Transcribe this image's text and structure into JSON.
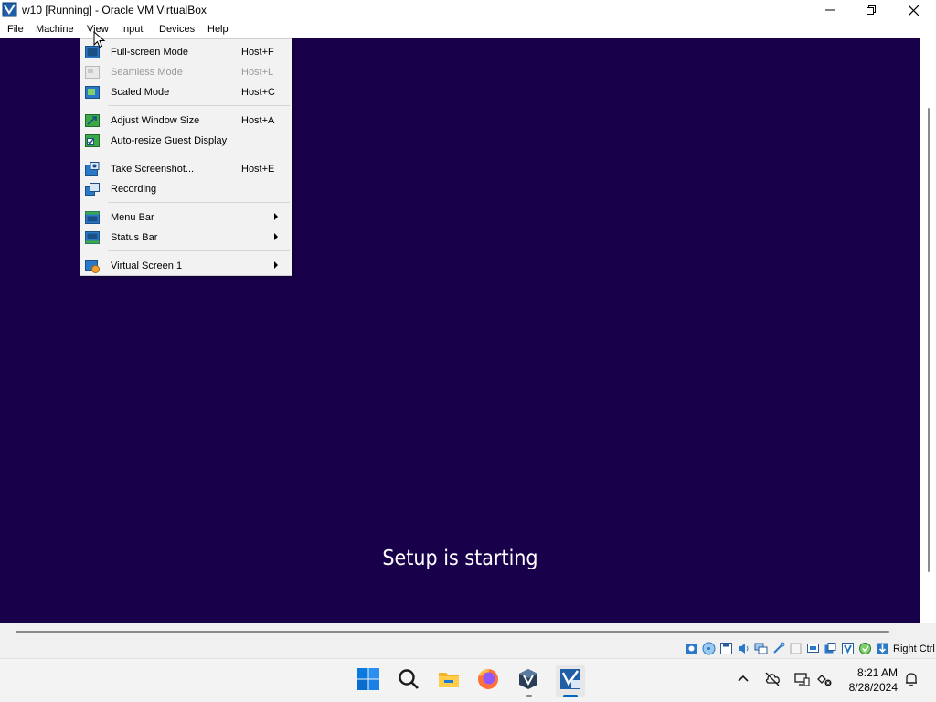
{
  "window": {
    "title": "w10 [Running] - Oracle VM VirtualBox",
    "controls": [
      "minimize-icon",
      "restore-icon",
      "close-icon"
    ]
  },
  "menubar": {
    "items": [
      "File",
      "Machine",
      "View",
      "Input",
      "Devices",
      "Help"
    ],
    "open_menu": "View"
  },
  "view_menu": {
    "items": [
      {
        "label": "Full-screen Mode",
        "shortcut": "Host+F",
        "icon": "fullscreen-icon",
        "enabled": true
      },
      {
        "label": "Seamless Mode",
        "shortcut": "Host+L",
        "icon": "seamless-icon",
        "enabled": false
      },
      {
        "label": "Scaled Mode",
        "shortcut": "Host+C",
        "icon": "scaled-icon",
        "enabled": true
      },
      {
        "label": "Adjust Window Size",
        "shortcut": "Host+A",
        "icon": "adjust-window-icon",
        "enabled": true
      },
      {
        "label": "Auto-resize Guest Display",
        "shortcut": "",
        "icon": "auto-resize-checkbox-icon",
        "enabled": true
      },
      {
        "label": "Take Screenshot...",
        "shortcut": "Host+E",
        "icon": "screenshot-icon",
        "enabled": true
      },
      {
        "label": "Recording",
        "shortcut": "",
        "icon": "recording-icon",
        "enabled": true
      },
      {
        "label": "Menu Bar",
        "shortcut": "",
        "icon": "menu-bar-icon",
        "submenu": true
      },
      {
        "label": "Status Bar",
        "shortcut": "",
        "icon": "status-bar-icon",
        "submenu": true
      },
      {
        "label": "Virtual Screen 1",
        "shortcut": "",
        "icon": "virtual-screen-icon",
        "submenu": true
      }
    ]
  },
  "guest": {
    "message": "Setup is starting",
    "background": "#19004b"
  },
  "statusbar": {
    "icons": [
      "hard-disk-icon",
      "optical-drive-icon",
      "floppy-icon",
      "audio-icon",
      "network-icon",
      "usb-icon",
      "shared-folders-icon",
      "display-icon",
      "video-capture-icon",
      "virtualization-icon",
      "guest-additions-icon",
      "mouse-integration-icon"
    ],
    "host_key": "Right Ctrl"
  },
  "taskbar": {
    "apps": [
      "windows-start-icon",
      "search-icon",
      "file-explorer-icon",
      "firefox-icon",
      "virtualbox-manager-icon",
      "virtualbox-vm-icon"
    ],
    "tray_icons": [
      "chevron-up-icon",
      "cloud-offline-icon",
      "display-settings-icon",
      "network-disconnected-icon",
      "notification-bell-icon"
    ],
    "time": "8:21 AM",
    "date": "8/28/2024"
  }
}
